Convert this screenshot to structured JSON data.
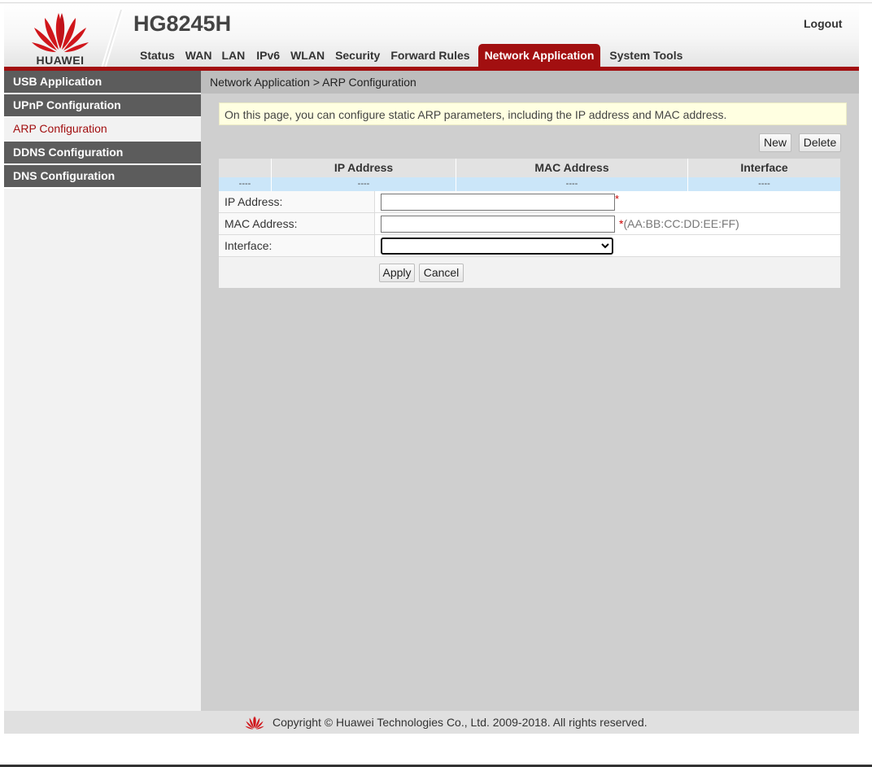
{
  "header": {
    "brand": "HUAWEI",
    "model": "HG8245H",
    "logout_label": "Logout",
    "accent_color": "#a20f10",
    "nav": [
      {
        "label": "Status"
      },
      {
        "label": "WAN"
      },
      {
        "label": "LAN"
      },
      {
        "label": "IPv6"
      },
      {
        "label": "WLAN"
      },
      {
        "label": "Security"
      },
      {
        "label": "Forward Rules"
      },
      {
        "label": "Network Application"
      },
      {
        "label": "System Tools"
      }
    ],
    "active_nav": "Network Application"
  },
  "sidebar": {
    "items": [
      {
        "label": "USB Application"
      },
      {
        "label": "UPnP Configuration"
      },
      {
        "label": "ARP Configuration"
      },
      {
        "label": "DDNS Configuration"
      },
      {
        "label": "DNS Configuration"
      }
    ],
    "active_item": "ARP Configuration"
  },
  "main": {
    "breadcrumb": "Network Application > ARP Configuration",
    "notice": "On this page, you can configure static ARP parameters, including the IP address and MAC address.",
    "new_label": "New",
    "delete_label": "Delete",
    "table": {
      "columns": [
        "",
        "IP Address",
        "MAC Address",
        "Interface"
      ],
      "rows": [
        [
          "----",
          "----",
          "----",
          "----"
        ]
      ]
    },
    "form": {
      "ip_label": "IP Address:",
      "ip_value": "",
      "ip_required": "*",
      "mac_label": "MAC Address:",
      "mac_value": "",
      "mac_hint": "*(AA:BB:CC:DD:EE:FF)",
      "interface_label": "Interface:",
      "interface_value": "",
      "apply_label": "Apply",
      "cancel_label": "Cancel"
    }
  },
  "footer": {
    "copyright": "Copyright © Huawei Technologies Co., Ltd. 2009-2018. All rights reserved."
  }
}
